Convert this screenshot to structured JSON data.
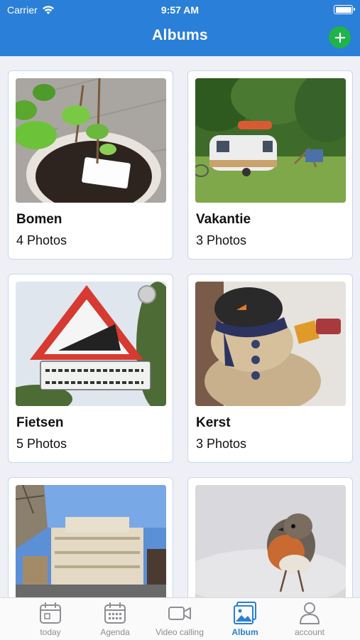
{
  "status_bar": {
    "carrier": "Carrier",
    "time": "9:57 AM"
  },
  "header": {
    "title": "Albums",
    "add_icon": "plus-icon"
  },
  "albums": [
    {
      "name": "Bomen",
      "count": "4 Photos"
    },
    {
      "name": "Vakantie",
      "count": "3 Photos"
    },
    {
      "name": "Fietsen",
      "count": "5 Photos"
    },
    {
      "name": "Kerst",
      "count": "3 Photos"
    },
    {
      "name": "",
      "count": ""
    },
    {
      "name": "",
      "count": ""
    }
  ],
  "tabbar": {
    "items": [
      {
        "label": "today",
        "icon": "calendar-day-icon"
      },
      {
        "label": "Agenda",
        "icon": "calendar-grid-icon"
      },
      {
        "label": "Video calling",
        "icon": "video-camera-icon"
      },
      {
        "label": "Album",
        "icon": "photo-album-icon"
      },
      {
        "label": "account",
        "icon": "person-icon"
      }
    ],
    "active": "Album"
  },
  "colors": {
    "header": "#2a7fd8",
    "add_button": "#1fb34a",
    "active_tab": "#2a7fd8",
    "inactive_tab": "#8e8e93",
    "background": "#eef0f5"
  }
}
